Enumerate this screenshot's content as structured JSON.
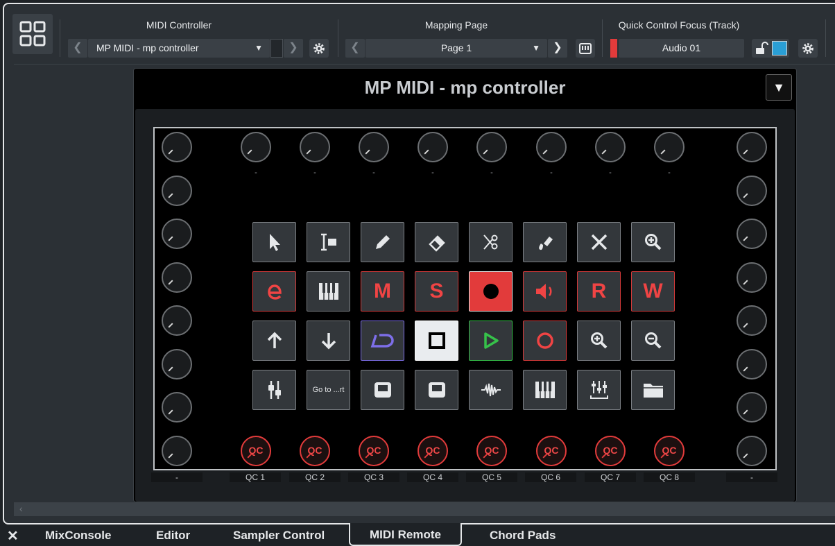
{
  "toolbar": {
    "midi_controller_label": "MIDI Controller",
    "midi_controller_value": "MP MIDI - mp controller",
    "mapping_page_label": "Mapping Page",
    "mapping_page_value": "Page 1",
    "qc_focus_label": "Quick Control Focus (Track)",
    "qc_focus_value": "Audio 01"
  },
  "panel": {
    "title": "MP MIDI - mp controller",
    "menu_glyph": "▼",
    "empty_label": "-",
    "knob_qc_text": "QC",
    "pad_goto_text": "Go to ...rt",
    "pad_letters": {
      "m": "M",
      "s": "S",
      "r": "R",
      "w": "W"
    },
    "qc_labels": [
      "QC 1",
      "QC 2",
      "QC 3",
      "QC 4",
      "QC 5",
      "QC 6",
      "QC 7",
      "QC 8"
    ]
  },
  "colors": {
    "accent_red": "#e23b3b",
    "play_green": "#36c24a",
    "cycle_purple": "#7d6ee8",
    "lock_blue": "#2a9fd6"
  },
  "tabs": [
    "MixConsole",
    "Editor",
    "Sampler Control",
    "MIDI Remote",
    "Chord Pads"
  ],
  "active_tab": "MIDI Remote"
}
